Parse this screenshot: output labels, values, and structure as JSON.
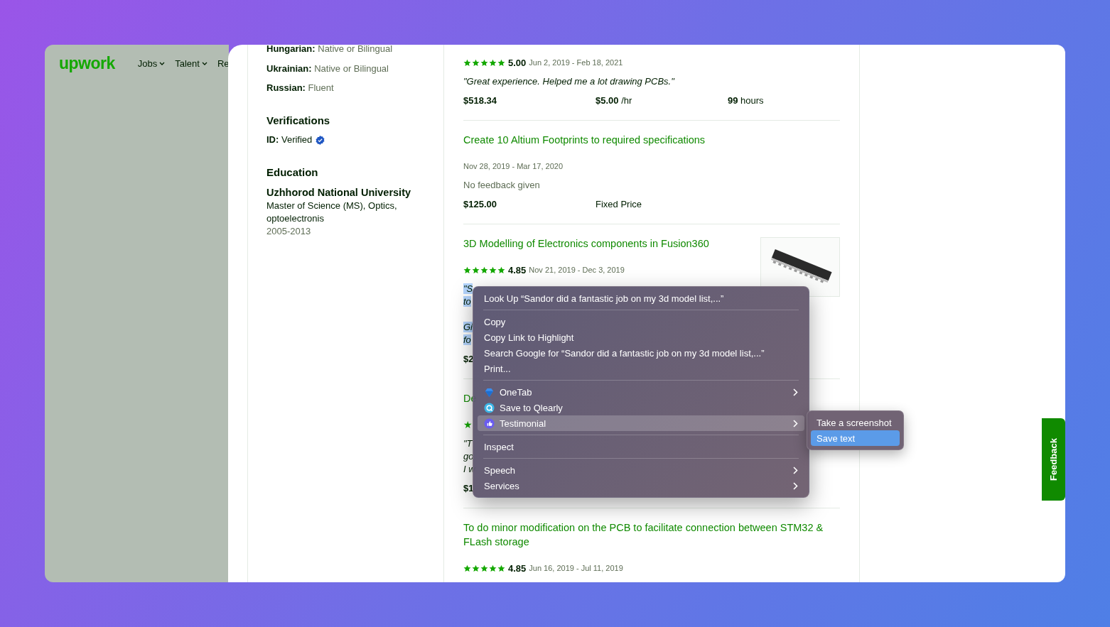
{
  "nav": {
    "logo": "upwork",
    "items": [
      {
        "label": "Jobs",
        "dropdown": true
      },
      {
        "label": "Talent",
        "dropdown": true
      },
      {
        "label": "Re",
        "dropdown": false
      }
    ]
  },
  "profile": {
    "languages": [
      {
        "name": "Hungarian:",
        "level": "Native or Bilingual"
      },
      {
        "name": "Ukrainian:",
        "level": "Native or Bilingual"
      },
      {
        "name": "Russian:",
        "level": "Fluent"
      }
    ],
    "verifications": {
      "heading": "Verifications",
      "label": "ID:",
      "value": "Verified",
      "verified": true
    },
    "education": {
      "heading": "Education",
      "school": "Uzhhorod National University",
      "degree_lines": [
        "Master of Science (MS), Optics,",
        "optoelectronis"
      ],
      "years": "2005-2013"
    }
  },
  "jobs": [
    {
      "stars": 5,
      "rating": "5.00",
      "dates": "Jun 2, 2019 - Feb 18, 2021",
      "quote_paragraphs": [
        [
          "\"Great experience. Helped me a lot drawing PCBs.\""
        ]
      ],
      "quote_selected": false,
      "stats": [
        {
          "value": "$518.34"
        },
        {
          "value": "$5.00",
          "suffix": "/hr"
        },
        {
          "value": "99",
          "suffix": "hours"
        }
      ]
    },
    {
      "title": "Create 10 Altium Footprints to required specifications",
      "dates": "Nov 28, 2019 - Mar 17, 2020",
      "feedback": "No feedback given",
      "stats": [
        {
          "value": "$125.00"
        },
        {
          "suffix": "Fixed Price"
        }
      ]
    },
    {
      "title": "3D Modelling of Electronics components in Fusion360",
      "thumbnail": true,
      "stars": 5,
      "rating": "4.85",
      "dates": "Nov 21, 2019 - Dec 3, 2019",
      "quote_paragraphs": [
        [
          "\"S",
          "to"
        ],
        [
          "Gi",
          "fo"
        ]
      ],
      "quote_selected": true,
      "stats": [
        {
          "value": "$2"
        }
      ]
    },
    {
      "title": "De",
      "star_glyph": "★",
      "quote_paragraphs": [
        [
          "\"T",
          "go",
          "I w"
        ]
      ],
      "quote_selected": false,
      "stats": [
        {
          "value": "$1"
        }
      ]
    },
    {
      "title": "To do minor modification on the PCB to facilitate connection between STM32 & FLash storage",
      "stars": 5,
      "rating": "4.85",
      "dates": "Jun 16, 2019 - Jul 11, 2019"
    }
  ],
  "context_menu": {
    "groups": [
      [
        {
          "label": "Look Up “Sandor did a fantastic job on my 3d model list,...”",
          "submenu": false,
          "selected": false
        }
      ],
      [
        {
          "label": "Copy",
          "submenu": false,
          "selected": false
        },
        {
          "label": "Copy Link to Highlight",
          "submenu": false,
          "selected": false
        },
        {
          "label": "Search Google for “Sandor did a fantastic job on my 3d model list,...”",
          "submenu": false,
          "selected": false
        },
        {
          "label": "Print...",
          "submenu": false,
          "selected": false
        }
      ],
      [
        {
          "label": "OneTab",
          "submenu": true,
          "selected": false
        },
        {
          "label": "Save to Qlearly",
          "submenu": false,
          "selected": false
        },
        {
          "label": "Testimonial",
          "submenu": true,
          "selected": true
        }
      ],
      [
        {
          "label": "Inspect",
          "submenu": false,
          "selected": false
        }
      ],
      [
        {
          "label": "Speech",
          "submenu": true,
          "selected": false
        },
        {
          "label": "Services",
          "submenu": true,
          "selected": false
        }
      ]
    ],
    "submenu": [
      {
        "label": "Take a screenshot",
        "selected": false
      },
      {
        "label": "Save text",
        "selected": true
      }
    ]
  },
  "feedback_tab": "Feedback"
}
